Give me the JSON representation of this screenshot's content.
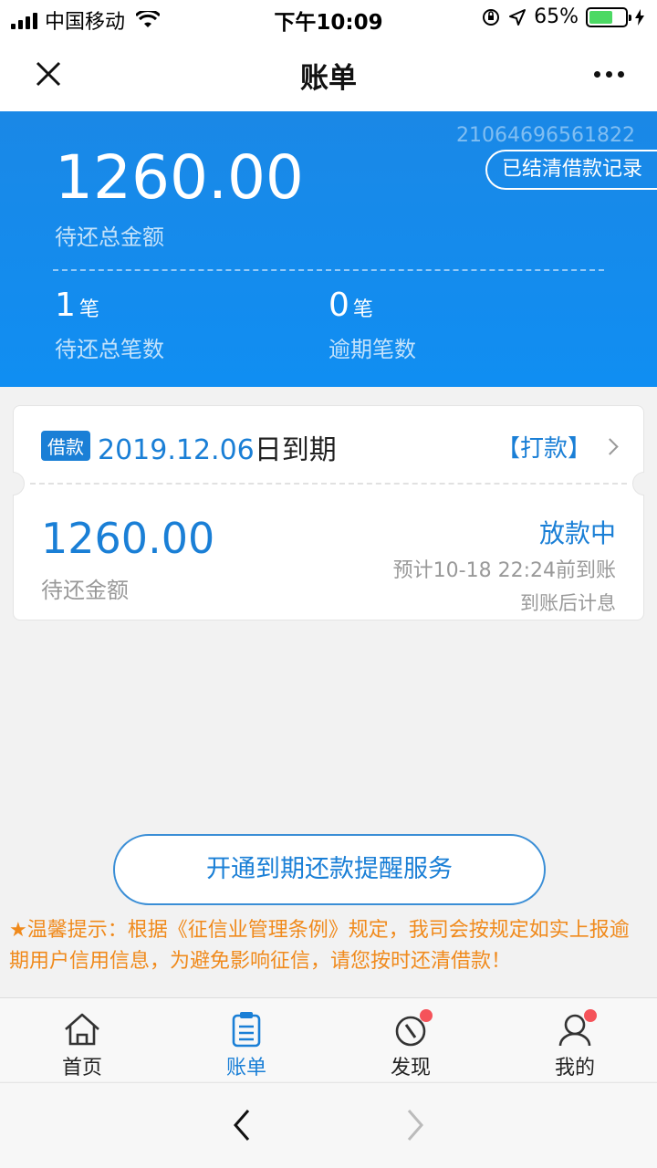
{
  "status_bar": {
    "carrier": "中国移动",
    "time": "下午10:09",
    "battery_text": "65%",
    "battery_level": 0.65
  },
  "nav": {
    "title": "账单"
  },
  "summary": {
    "bill_id": "21064696561822",
    "settled_button": "已结清借款记录",
    "total_amount": "1260.00",
    "total_label": "待还总金额",
    "pending_count": "1",
    "pending_unit": "笔",
    "pending_label": "待还总笔数",
    "overdue_count": "0",
    "overdue_unit": "笔",
    "overdue_label": "逾期笔数"
  },
  "loan_card": {
    "tag": "借款",
    "due_date": "2019.12.06",
    "due_suffix": "日到期",
    "pay_link": "【打款】",
    "amount": "1260.00",
    "amount_label": "待还金额",
    "status": "放款中",
    "eta": "预计10-18 22:24前到账",
    "interest_note": "到账后计息"
  },
  "reminder": {
    "button": "开通到期还款提醒服务",
    "tip": "★温馨提示：根据《征信业管理条例》规定，我司会按规定如实上报逾期用户信用信息，为避免影响征信，请您按时还清借款！"
  },
  "tabs": [
    {
      "label": "首页",
      "icon": "home-icon",
      "active": false
    },
    {
      "label": "账单",
      "icon": "bill-icon",
      "active": true
    },
    {
      "label": "发现",
      "icon": "compass-icon",
      "active": false
    },
    {
      "label": "我的",
      "icon": "user-icon",
      "active": false
    }
  ],
  "colors": {
    "primary": "#1a7fd6",
    "header_blue": "#108ef2",
    "tip_orange": "#f08a1c",
    "badge_red": "#f5535a"
  }
}
